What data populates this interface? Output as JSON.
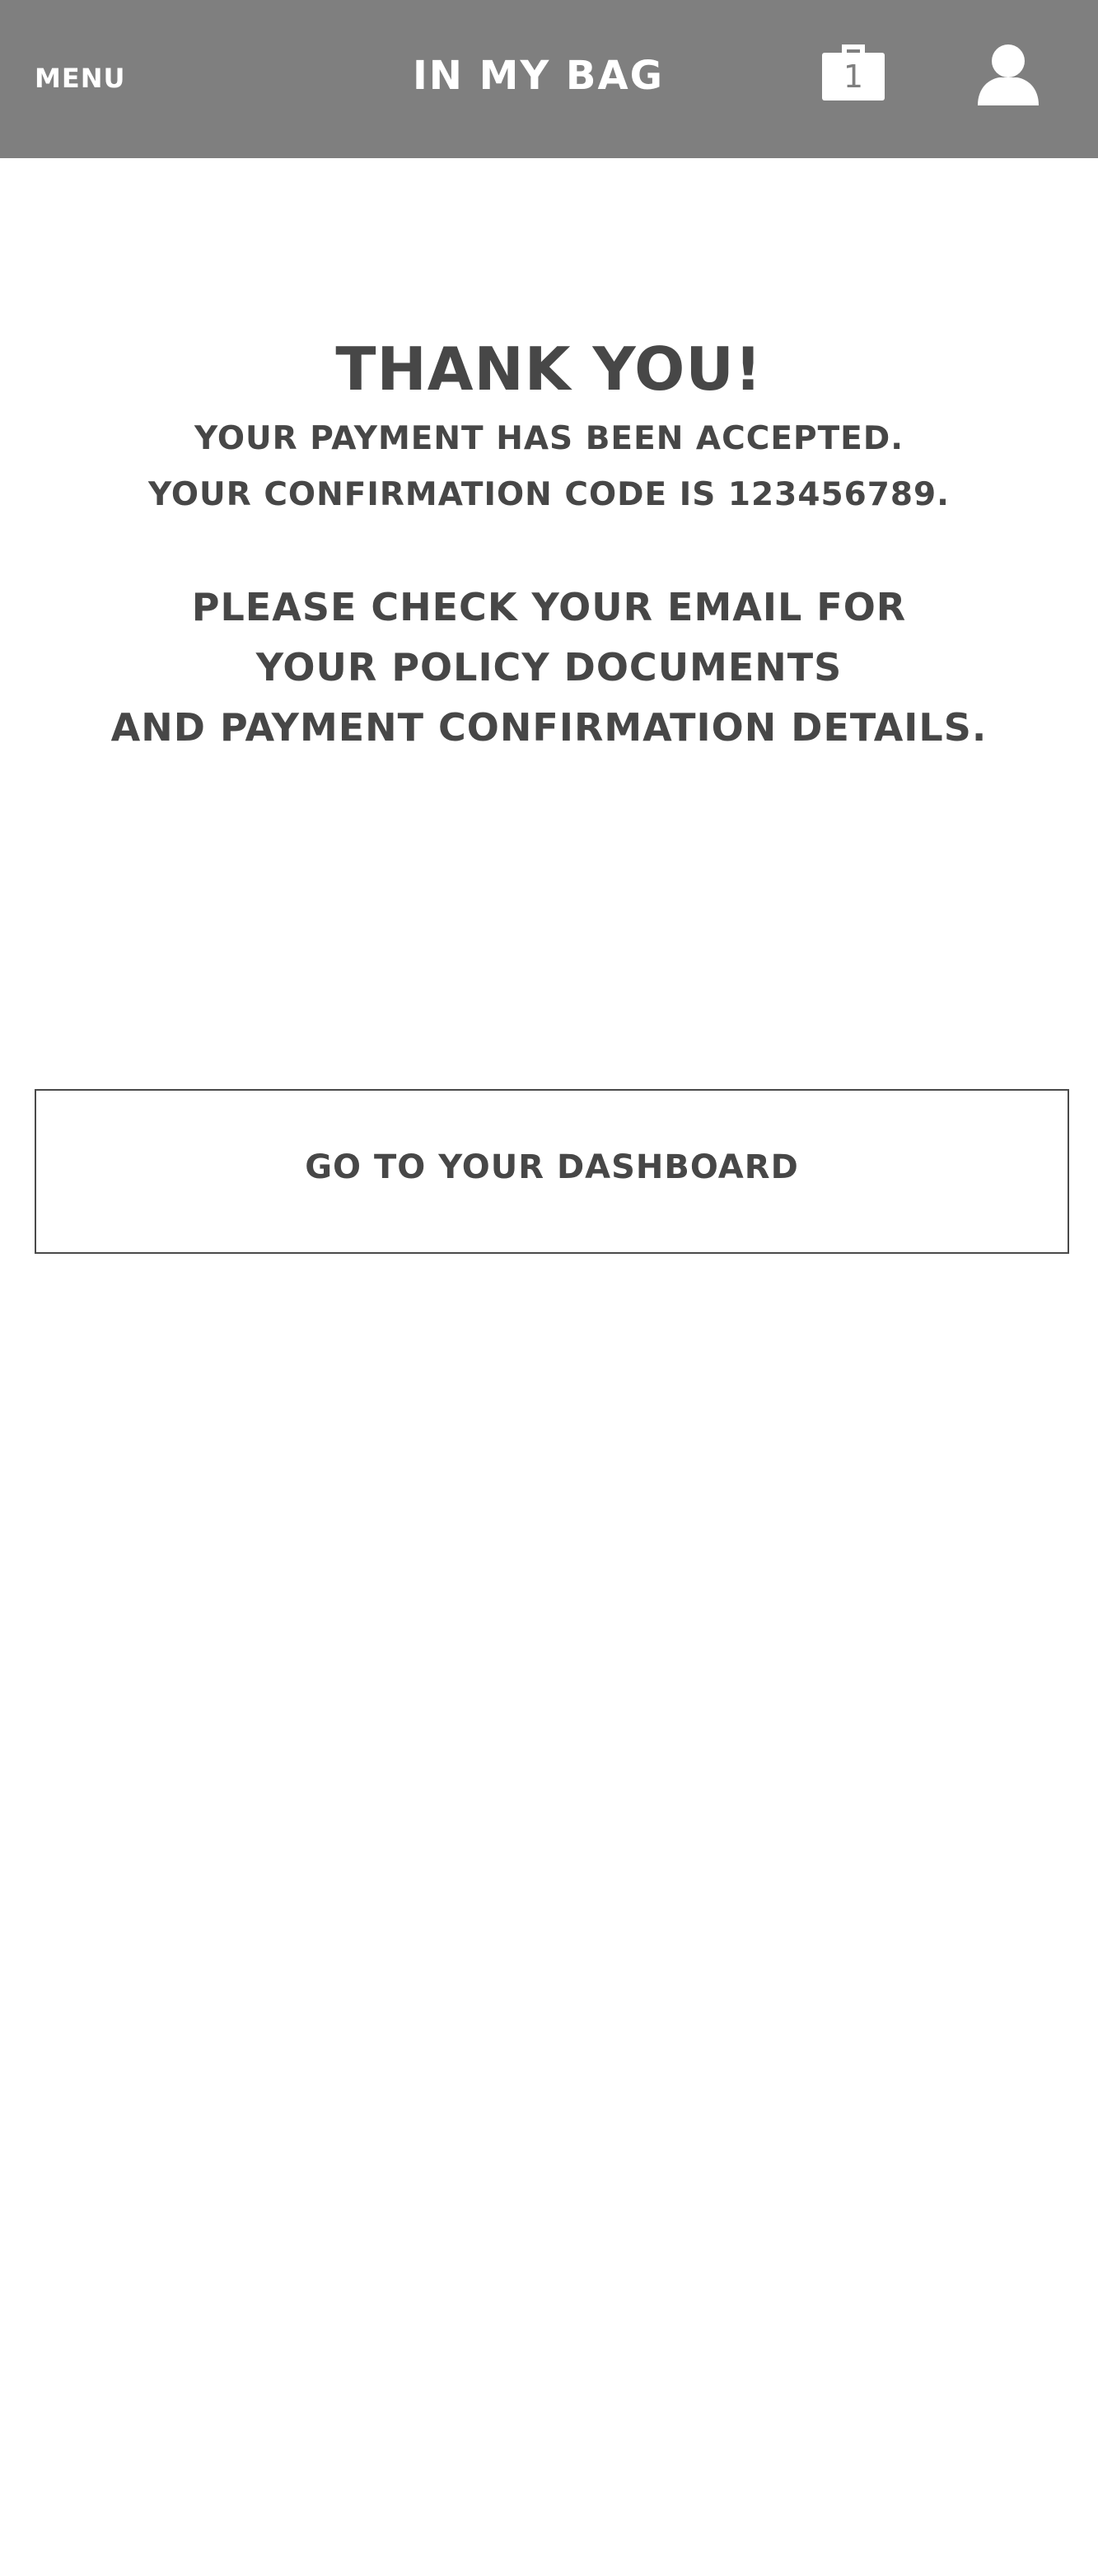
{
  "header": {
    "menu_label": "MENU",
    "title": "IN MY BAG",
    "bag_icon": "shopping-bag-icon",
    "bag_count": "1",
    "user_icon": "user-profile-icon"
  },
  "confirmation": {
    "title": "THANK YOU!",
    "line1": "YOUR PAYMENT HAS BEEN ACCEPTED.",
    "line2": "YOUR CONFIRMATION CODE IS 123456789.",
    "email_line1": "PLEASE CHECK YOUR EMAIL FOR",
    "email_line2": "YOUR POLICY DOCUMENTS",
    "email_line3": "AND PAYMENT CONFIRMATION DETAILS."
  },
  "actions": {
    "dashboard_label": "GO TO YOUR DASHBOARD"
  },
  "colors": {
    "header_bg": "#7f7f7f",
    "text": "#474747",
    "background": "#ffffff"
  }
}
